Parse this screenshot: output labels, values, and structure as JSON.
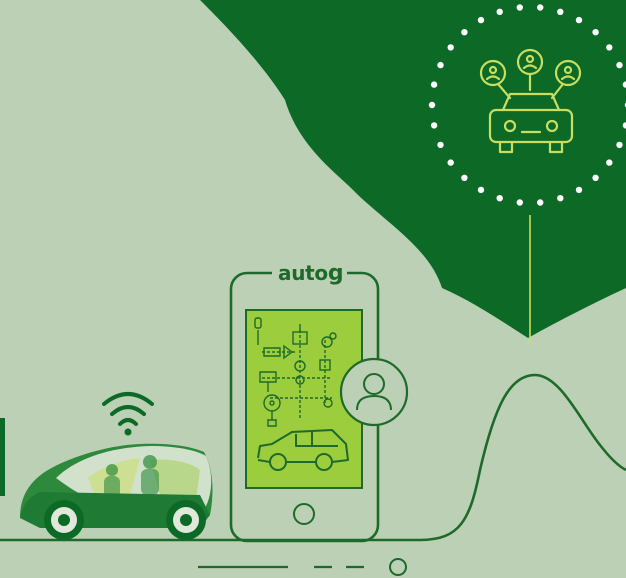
{
  "brand": {
    "wordmark_text": "auto",
    "wordmark_glyph": "g",
    "logo": "autogarage-logo"
  },
  "colors": {
    "background": "#bcd0b5",
    "dark_green": "#0d6a26",
    "line_green": "#1e6a2a",
    "screen_green": "#9ccd3c",
    "accent_lime": "#c8de62",
    "white": "#ffffff"
  },
  "icons": {
    "car_sharing": "shared-car-icon",
    "user": "user-profile-icon",
    "wifi": "wifi-icon",
    "smartphone": "smartphone-icon",
    "connected_car": "connected-car-icon",
    "car_parts": "car-parts-diagram-icon",
    "home_button": "home-button-icon"
  }
}
